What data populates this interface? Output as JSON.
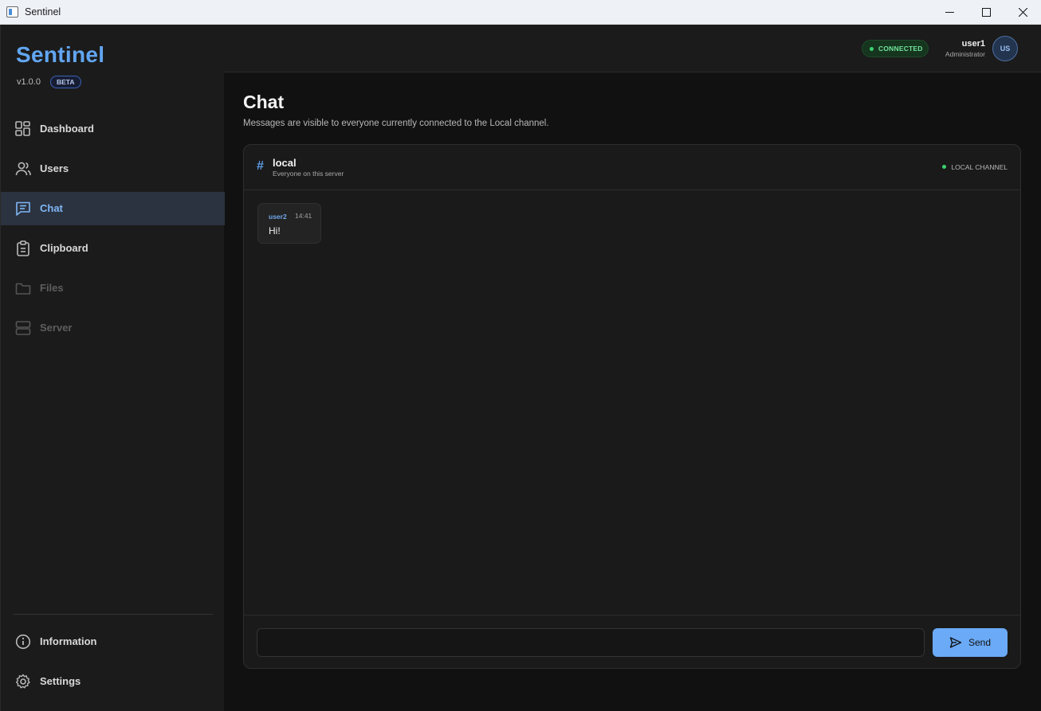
{
  "window": {
    "title": "Sentinel"
  },
  "sidebar": {
    "brand": "Sentinel",
    "version": "v1.0.0",
    "badge": "BETA",
    "items": [
      {
        "label": "Dashboard",
        "icon": "dashboard-icon",
        "state": "normal"
      },
      {
        "label": "Users",
        "icon": "users-icon",
        "state": "normal"
      },
      {
        "label": "Chat",
        "icon": "chat-icon",
        "state": "active"
      },
      {
        "label": "Clipboard",
        "icon": "clipboard-icon",
        "state": "normal"
      },
      {
        "label": "Files",
        "icon": "folder-icon",
        "state": "disabled"
      },
      {
        "label": "Server",
        "icon": "server-icon",
        "state": "disabled"
      }
    ],
    "bottom_items": [
      {
        "label": "Information",
        "icon": "info-icon"
      },
      {
        "label": "Settings",
        "icon": "settings-icon"
      }
    ]
  },
  "header": {
    "status": "CONNECTED",
    "user_name": "user1",
    "user_role": "Administrator",
    "avatar_initials": "US"
  },
  "main": {
    "title": "Chat",
    "subtitle": "Messages are visible to everyone currently connected to the Local channel."
  },
  "channel": {
    "name": "local",
    "description": "Everyone on this server",
    "badge": "LOCAL CHANNEL"
  },
  "messages": [
    {
      "author": "user2",
      "time": "14:41",
      "text": "Hi!"
    }
  ],
  "composer": {
    "value": "",
    "send_label": "Send"
  },
  "colors": {
    "accent": "#62a6f2",
    "status_green": "#3ad36e",
    "send_button": "#6aaaf7"
  }
}
